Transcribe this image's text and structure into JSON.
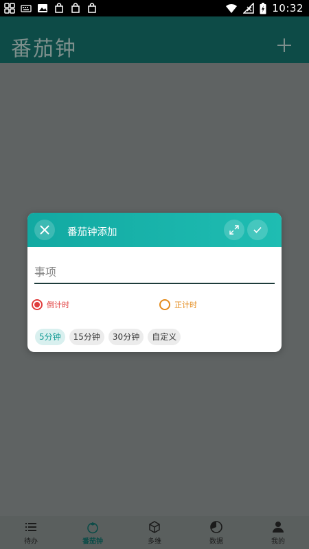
{
  "status_bar": {
    "time": "10:32",
    "left_icons": [
      "grid-icon",
      "keyboard-icon",
      "image-icon",
      "bag-icon",
      "bag-icon",
      "bag-icon"
    ],
    "right_icons": [
      "wifi-icon",
      "signal-icon",
      "battery-charging-icon"
    ]
  },
  "appbar": {
    "title": "番茄钟",
    "add_icon": "plus-icon"
  },
  "dialog": {
    "title": "番茄钟添加",
    "task_placeholder": "事项",
    "radio_countdown_label": "倒计时",
    "radio_countup_label": "正计时",
    "selected_mode": "倒计时",
    "chips": [
      "5分钟",
      "15分钟",
      "30分钟",
      "自定义"
    ],
    "selected_chip": "5分钟"
  },
  "bottom_nav": {
    "items": [
      {
        "label": "待办",
        "icon": "list-icon"
      },
      {
        "label": "番茄钟",
        "icon": "tomato-icon"
      },
      {
        "label": "多维",
        "icon": "cube-icon"
      },
      {
        "label": "数据",
        "icon": "pie-chart-icon"
      },
      {
        "label": "我的",
        "icon": "person-icon"
      }
    ],
    "active": "番茄钟"
  },
  "colors": {
    "appbar": "#0d4b47",
    "dialog_header_start": "#12a9a2",
    "dialog_header_end": "#1fbdb2",
    "countdown_red": "#e03c3c",
    "countup_orange": "#e38a1a",
    "chip_active": "#139b95"
  }
}
